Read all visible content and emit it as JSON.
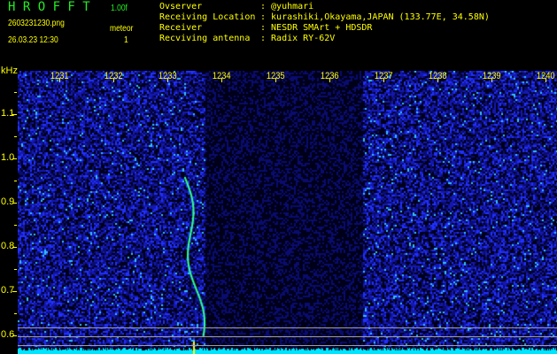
{
  "header": {
    "brand": "H R O F F T",
    "version": "1.00f",
    "filename": "2603231230.png",
    "datetime": "26.03.23 12:30",
    "meteor_label": "meteor",
    "meteor_count": "1"
  },
  "info": [
    {
      "label": "Ovserver",
      "value": ": @yuhmari"
    },
    {
      "label": "Receiving Location",
      "value": ": kurashiki,Okayama,JAPAN (133.77E, 34.58N)"
    },
    {
      "label": "Receiver",
      "value": ": NESDR SMArt + HDSDR"
    },
    {
      "label": "Recviving antenna",
      "value": ": Radix RY-62V"
    }
  ],
  "axis": {
    "y_unit": "kHz",
    "y_labels": [
      "1.1",
      "1.0",
      "0.9",
      "0.8",
      "0.7",
      "0.6"
    ],
    "x_labels": [
      "1231",
      "1232",
      "1233",
      "1234",
      "1235",
      "1236",
      "1237",
      "1238",
      "1239",
      "1240"
    ]
  },
  "colors": {
    "text": "#ffff00",
    "brand": "#22ee22",
    "baseline": "#00e5ff"
  }
}
